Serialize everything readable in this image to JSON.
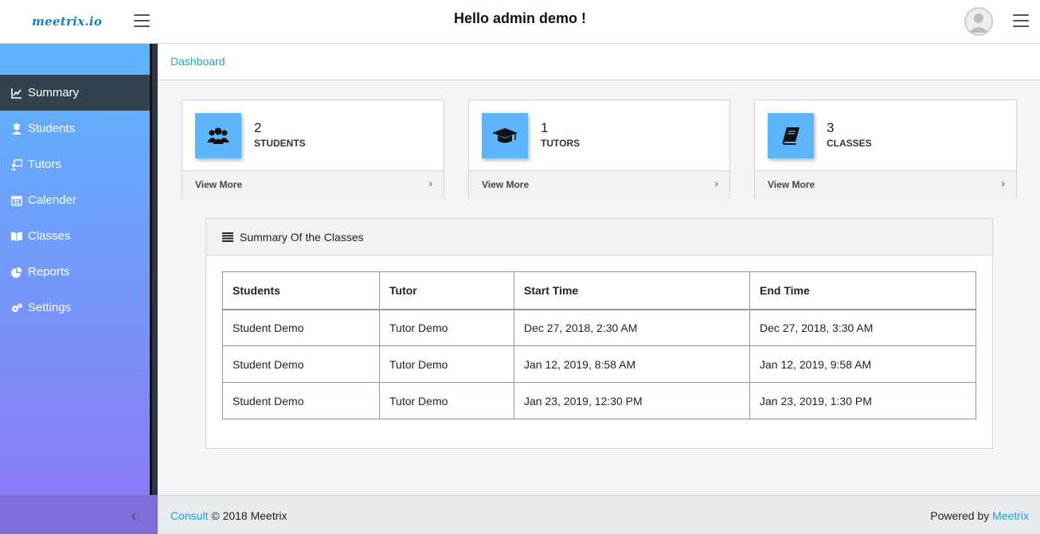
{
  "header": {
    "logo": "meetrix.io",
    "greeting": "Hello admin demo !"
  },
  "sidebar": {
    "items": [
      {
        "label": "Summary",
        "icon": "chart-line-icon"
      },
      {
        "label": "Students",
        "icon": "user-graduate-icon"
      },
      {
        "label": "Tutors",
        "icon": "chalkboard-teacher-icon"
      },
      {
        "label": "Calender",
        "icon": "calendar-icon"
      },
      {
        "label": "Classes",
        "icon": "book-open-icon"
      },
      {
        "label": "Reports",
        "icon": "pie-chart-icon"
      },
      {
        "label": "Settings",
        "icon": "gears-icon"
      }
    ],
    "active": "Summary"
  },
  "breadcrumb": {
    "label": "Dashboard"
  },
  "cards": [
    {
      "count": "2",
      "label": "STUDENTS",
      "more": "View More",
      "icon": "users-icon"
    },
    {
      "count": "1",
      "label": "TUTORS",
      "more": "View More",
      "icon": "graduation-cap-icon"
    },
    {
      "count": "3",
      "label": "CLASSES",
      "more": "View More",
      "icon": "book-icon"
    }
  ],
  "summary": {
    "title": "Summary Of the Classes",
    "columns": [
      "Students",
      "Tutor",
      "Start Time",
      "End Time"
    ],
    "rows": [
      [
        "Student Demo",
        "Tutor Demo",
        "Dec 27, 2018, 2:30 AM",
        "Dec 27, 2018, 3:30 AM"
      ],
      [
        "Student Demo",
        "Tutor Demo",
        "Jan 12, 2019, 8:58 AM",
        "Jan 12, 2019, 9:58 AM"
      ],
      [
        "Student Demo",
        "Tutor Demo",
        "Jan 23, 2019, 12:30 PM",
        "Jan 23, 2019, 1:30 PM"
      ]
    ]
  },
  "footer": {
    "left_link": "Consult",
    "left_text": "© 2018 Meetrix",
    "right_text": "Powered by",
    "right_link": "Meetrix"
  },
  "colors": {
    "accent": "#1fa2d4",
    "tile": "#5db5fc",
    "sidebar_top": "#5db5fc",
    "sidebar_bottom": "#8a7cf7",
    "active_item": "#33424f"
  }
}
